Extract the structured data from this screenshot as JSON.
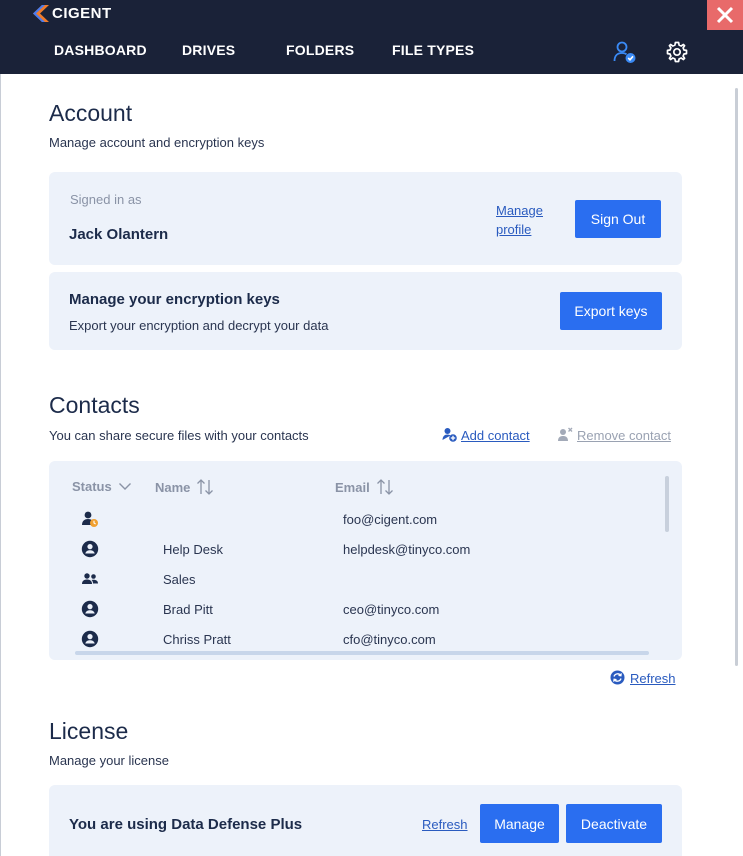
{
  "app": {
    "logo_text": "CIGENT"
  },
  "nav": {
    "items": [
      "DASHBOARD",
      "DRIVES",
      "FOLDERS",
      "FILE TYPES"
    ]
  },
  "account": {
    "title": "Account",
    "subtitle": "Manage account and encryption keys",
    "signed_in_label": "Signed in as",
    "user_name": "Jack Olantern",
    "manage_profile_line1": "Manage",
    "manage_profile_line2": "profile",
    "sign_out_label": "Sign Out"
  },
  "keys": {
    "title": "Manage your encryption keys",
    "subtitle": "Export your encryption and decrypt your data",
    "export_label": "Export keys"
  },
  "contacts": {
    "title": "Contacts",
    "subtitle": "You can share secure files with your contacts",
    "add_label": "Add contact",
    "remove_label": "Remove contact",
    "columns": {
      "status": "Status",
      "name": "Name",
      "email": "Email"
    },
    "rows": [
      {
        "icon": "pending-user-icon",
        "name": "",
        "email": "foo@cigent.com"
      },
      {
        "icon": "user-icon",
        "name": "Help Desk",
        "email": "helpdesk@tinyco.com"
      },
      {
        "icon": "group-icon",
        "name": "Sales",
        "email": ""
      },
      {
        "icon": "user-icon",
        "name": "Brad Pitt",
        "email": "ceo@tinyco.com"
      },
      {
        "icon": "user-icon",
        "name": "Chriss Pratt",
        "email": "cfo@tinyco.com"
      }
    ],
    "refresh_label": "Refresh"
  },
  "license": {
    "title": "License",
    "subtitle": "Manage your license",
    "status_text": "You are using Data Defense Plus",
    "refresh_label": "Refresh",
    "manage_label": "Manage",
    "deactivate_label": "Deactivate"
  },
  "colors": {
    "header_bg": "#1a2238",
    "primary_button": "#2a6ef0",
    "card_bg": "#edf2fa",
    "close_button": "#e86a6a",
    "logo_accent": "#f07a2a",
    "user_icon": "#1c2b4a",
    "pending_badge": "#f0a030"
  }
}
